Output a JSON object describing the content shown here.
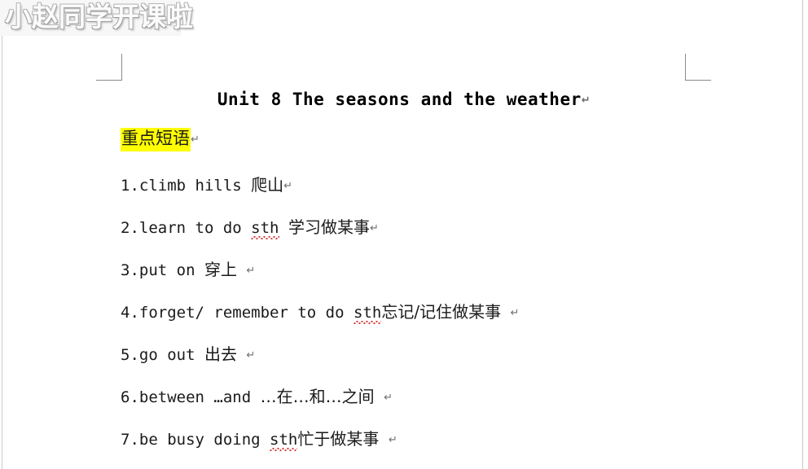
{
  "watermark": {
    "text": "小赵同学开课啦"
  },
  "document": {
    "title": "Unit 8 The seasons and the weather",
    "pilcrow": "↵",
    "heading": {
      "text": "重点短语",
      "highlight_color": "#ffff00"
    },
    "lines": [
      {
        "number": "1.",
        "english": "climb hills ",
        "chinese": "爬山",
        "misspelled": "",
        "english_tail": "",
        "trailing_space": ""
      },
      {
        "number": "2.",
        "english": "learn to do ",
        "misspelled": "sth",
        "english_tail": " ",
        "chinese": "学习做某事",
        "trailing_space": ""
      },
      {
        "number": "3.",
        "english": "put on ",
        "misspelled": "",
        "english_tail": "",
        "chinese": "穿上",
        "trailing_space": "  "
      },
      {
        "number": "4.",
        "english": "forget/ remember to do ",
        "misspelled": "sth",
        "english_tail": "",
        "chinese": "忘记/记住做某事",
        "trailing_space": "  "
      },
      {
        "number": "5.",
        "english": "go out ",
        "misspelled": "",
        "english_tail": "",
        "chinese": "出去",
        "trailing_space": "    "
      },
      {
        "number": "6.",
        "english": "between ",
        "misspelled": "",
        "english_tail": "…and ",
        "chinese": "…在…和…之间",
        "trailing_space": "  "
      },
      {
        "number": "7.",
        "english": "be busy doing ",
        "misspelled": "sth",
        "english_tail": "",
        "chinese": "忙于做某事",
        "trailing_space": "    "
      }
    ]
  },
  "colors": {
    "highlight": "#ffff00",
    "spellcheck_underline": "#d43a3a",
    "margin_mark": "#8a8a8a",
    "text": "#1a1a1a"
  }
}
